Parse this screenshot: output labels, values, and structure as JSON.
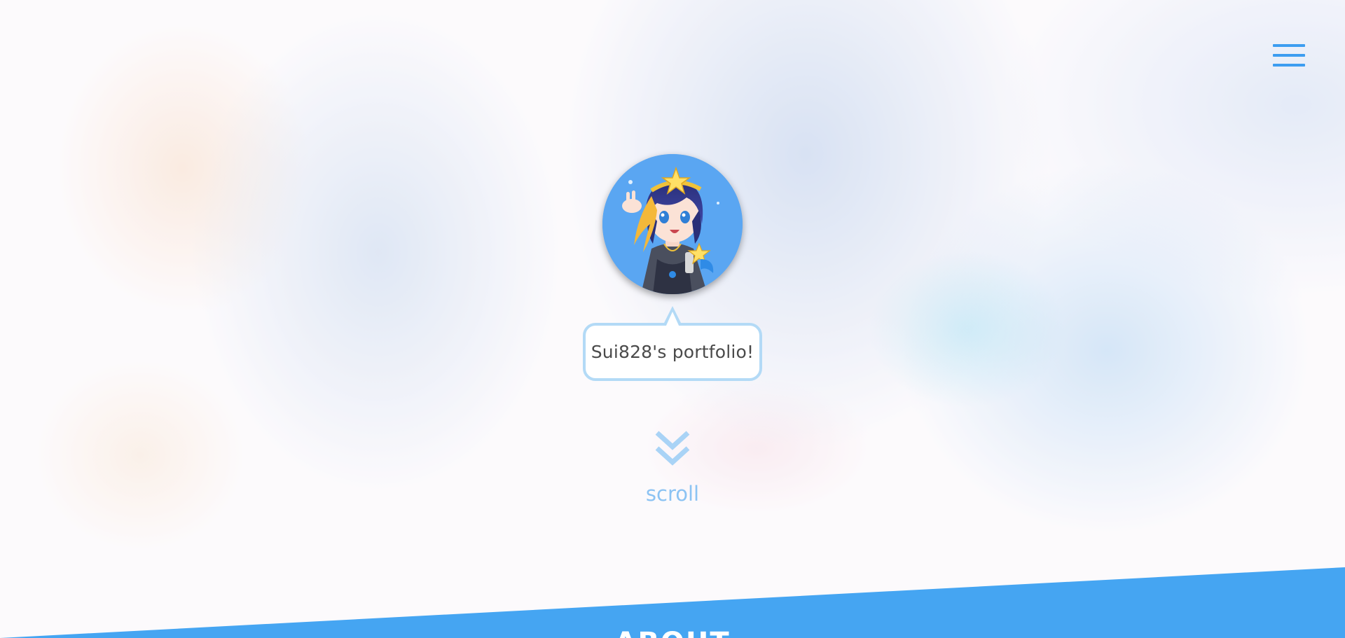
{
  "header": {
    "menu_icon": "hamburger-menu-icon"
  },
  "hero": {
    "avatar_alt": "avatar illustration",
    "bubble_text": "Sui828's portfolio!",
    "scroll_icon": "double-chevron-down-icon",
    "scroll_label": "scroll"
  },
  "about": {
    "title": "ABOUT"
  },
  "colors": {
    "accent": "#3d9df0",
    "band": "#45a5f2",
    "bubble_border": "#b3daf6",
    "scroll_text": "#8cc3f3"
  }
}
